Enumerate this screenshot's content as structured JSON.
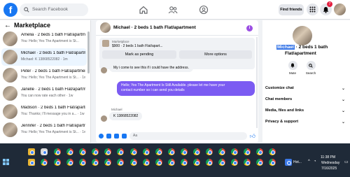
{
  "topbar": {
    "logo": "f",
    "search_placeholder": "Search Facebook",
    "find_friends": "Find friends",
    "notif_count": "7"
  },
  "marketplace": {
    "heading": "Marketplace",
    "conversations": [
      {
        "title": "Amelia · 2 beds 1 bath Flat/apartm...",
        "sub": "You: Hello; Yes The Apartment is St..."
      },
      {
        "title": "Michael · 2 beds 1 bath Flat/apartm...",
        "sub": "Michael: K 13868522082 · 1m"
      },
      {
        "title": "Peter · 2 beds 1 bath Flat/apartment",
        "sub": "You: Hello; Yes The Apartment is St... · 1w"
      },
      {
        "title": "Janelle · 2 beds 1 bath Flat/apartm...",
        "sub": "You can now rate each other · 1w"
      },
      {
        "title": "Madison · 2 beds 1 bath Flat/apartm...",
        "sub": "You: Thanks; I'll message you in a... · 1w"
      },
      {
        "title": "Jennifer · 2 beds 1 bath Flat/apartm...",
        "sub": "You: Hello; Yes The Apartment is St... · 1w"
      }
    ]
  },
  "chat": {
    "title": "Michael · 2 beds 1 bath Flat/apartment",
    "listing_source": "Marketplace",
    "listing_price": "$900 · 2 beds 1 bath Flat/apart...",
    "mark_pending": "Mark as pending",
    "more_options": "More options",
    "msg1": "My i come to see this if i could have the address.",
    "msg2_line1": "Hello; Yes The Apartment Is Still Available. please let me have your",
    "msg2_line2": "contact number so i can send you details",
    "sender": "Michael",
    "msg3": "K 13868522082",
    "composer_placeholder": "Aa"
  },
  "details": {
    "name_highlight": "Michael",
    "name_rest": " · 2 beds 1 bath",
    "name_line2": "Flat/apartment",
    "mute": "Mute",
    "search": "Search",
    "sections": [
      "Customize chat",
      "Chat members",
      "Media, files and links",
      "Privacy & support"
    ]
  },
  "taskbar": {
    "app_label": "Hot...",
    "time": "11:38 PM",
    "day": "Wednesday",
    "date": "7/16/2025"
  }
}
